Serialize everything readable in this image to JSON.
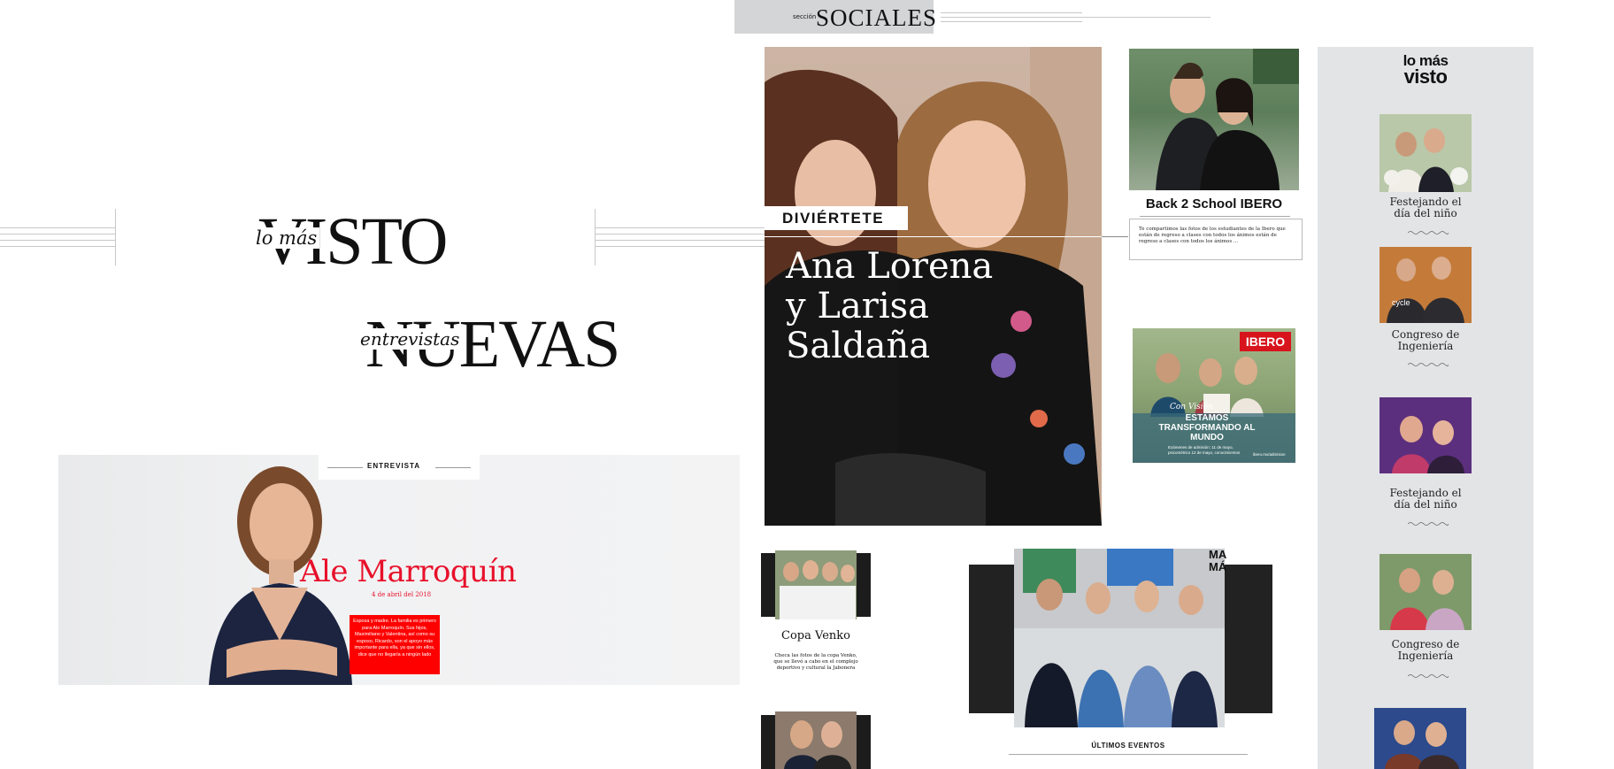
{
  "seccion": {
    "small": "sección",
    "title": "SOCIALES"
  },
  "headings": {
    "visto": {
      "small": "lo más",
      "big": "VISTO"
    },
    "nuevas": {
      "small": "entrevistas",
      "big": "NUEVAS"
    }
  },
  "interview": {
    "tag": "ENTREVISTA",
    "name": "Ale Marroquín",
    "date": "4 de abril del 2018",
    "excerpt": "Esposa y madre. La familia es primero para Ale Marroquín. Sus hijos, Maximiliano y Valentina, así como su esposo, Ricardo, son el apoyo más importante para ella, ya que sin ellos, dice que no llegaría a ningún lado"
  },
  "feature": {
    "badge": "DIVIÉRTETE",
    "title_lines": [
      "Ana Lorena",
      "y Larisa",
      "Saldaña"
    ]
  },
  "back2school": {
    "title": "Back 2 School IBERO",
    "text": "Te compartimos las fotos de los estudiantes de la Ibero que están de regreso a clases con todos los ánimos están de regreso a clases con todos los ánimos ..."
  },
  "ibero_ad": {
    "brand": "IBERO",
    "script": "Con Visión",
    "headline": "ESTAMOS TRANSFORMANDO AL MUNDO",
    "small": "Exámenes de admisión: 11 de mayo, psicométrico 12 de mayo, conocimientos",
    "url": "ibero.mx/admision"
  },
  "copa": {
    "title": "Copa Venko",
    "text": "Checa las fotos de la copa Venko, que se llevó a cabo en el complejo deportivo y cultural la Jabonera"
  },
  "ultimos": {
    "label": "ÚLTIMOS EVENTOS",
    "corner": "MA MÁ"
  },
  "sidebar": {
    "logo_top": "lo más",
    "logo_bottom": "visto",
    "items": [
      {
        "title": "Festejando el día del niño"
      },
      {
        "title": "Congreso de Ingeniería"
      },
      {
        "title": "Festejando el día del niño"
      },
      {
        "title": "Congreso de Ingeniería"
      }
    ],
    "cycle_text": "cycle"
  },
  "colors": {
    "accent_red": "#e8102a",
    "badge_gray": "#d4d5d7",
    "sidebar_bg": "#e3e4e6"
  }
}
